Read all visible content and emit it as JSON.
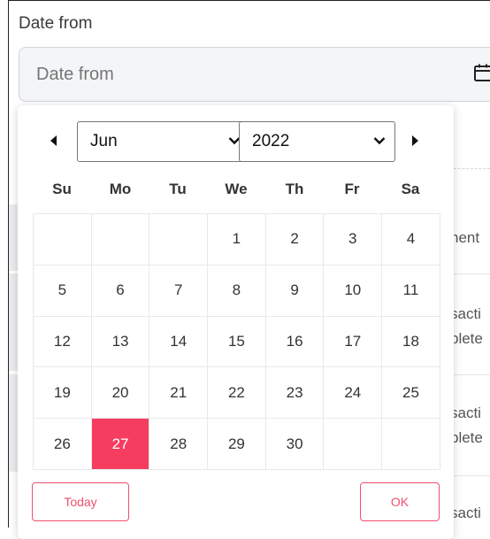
{
  "date_field": {
    "label": "Date from",
    "placeholder": "Date from"
  },
  "background": {
    "fragments": [
      "nent",
      "sacti",
      "plete",
      "sacti",
      "plete",
      "sacti"
    ]
  },
  "calendar": {
    "selected_month": "Jun",
    "selected_year": "2022",
    "weekdays": [
      "Su",
      "Mo",
      "Tu",
      "We",
      "Th",
      "Fr",
      "Sa"
    ],
    "days": [
      [
        "",
        "",
        "",
        "1",
        "2",
        "3",
        "4"
      ],
      [
        "5",
        "6",
        "7",
        "8",
        "9",
        "10",
        "11"
      ],
      [
        "12",
        "13",
        "14",
        "15",
        "16",
        "17",
        "18"
      ],
      [
        "19",
        "20",
        "21",
        "22",
        "23",
        "24",
        "25"
      ],
      [
        "26",
        "27",
        "28",
        "29",
        "30",
        "",
        ""
      ]
    ],
    "selected_day": "27",
    "today_label": "Today",
    "ok_label": "OK"
  },
  "colors": {
    "accent": "#f53d60",
    "button_border": "#f0506e"
  }
}
